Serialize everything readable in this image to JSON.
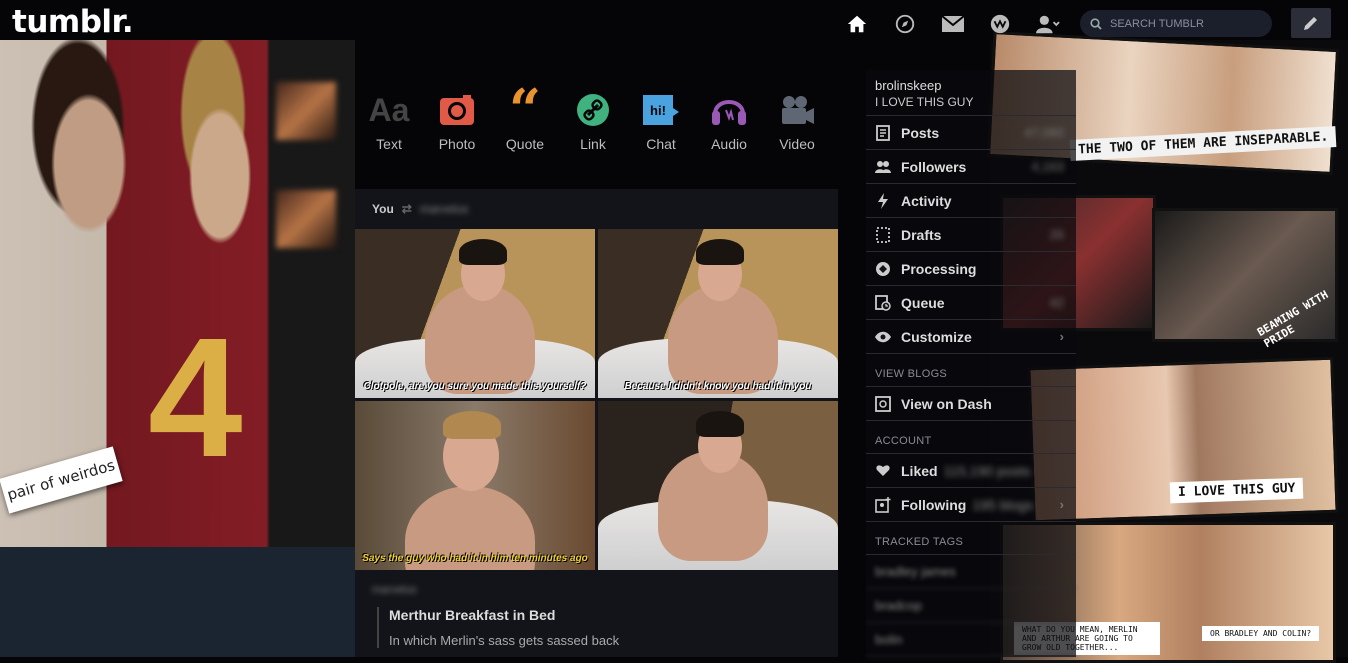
{
  "app": {
    "logo": "tumblr.",
    "search_placeholder": "Search Tumblr",
    "nav_icons": [
      "home-icon",
      "explore-icon",
      "inbox-icon",
      "activity-icon",
      "account-icon",
      "compose-icon"
    ]
  },
  "background": {
    "left_caption": "pair of weirdos",
    "right_captions": [
      "THE TWO OF THEM ARE INSEPARABLE.",
      "I LOVE THIS GUY",
      "BEAMING WITH PRIDE",
      "WHAT DO YOU MEAN, MERLIN AND ARTHUR ARE GOING TO GROW OLD TOGETHER...",
      "OR BRADLEY AND COLIN?"
    ]
  },
  "post_types": [
    {
      "label": "Text",
      "icon": "text-icon",
      "color": "#444444"
    },
    {
      "label": "Photo",
      "icon": "camera-icon",
      "color": "#e05a47"
    },
    {
      "label": "Quote",
      "icon": "quote-icon",
      "color": "#e8932d"
    },
    {
      "label": "Link",
      "icon": "link-icon",
      "color": "#3fb27f"
    },
    {
      "label": "Chat",
      "icon": "chat-icon",
      "color": "#4aa3df"
    },
    {
      "label": "Audio",
      "icon": "headphones-icon",
      "color": "#9b59b6"
    },
    {
      "label": "Video",
      "icon": "video-icon",
      "color": "#5f6775"
    }
  ],
  "post": {
    "author": "You",
    "reblogged_from": "marvelus",
    "subtitles": [
      "Clotpole, are you sure you made this yourself?",
      "Because I didn't know you had it in you",
      "Says the guy who had it in him ten minutes ago",
      ""
    ],
    "source_blog": "marvelus",
    "title": "Merthur Breakfast in Bed",
    "summary": "In which Merlin's sass gets sassed back"
  },
  "sidebar": {
    "blog_name": "brolinskeep",
    "blog_title": "I LOVE THIS GUY",
    "items": [
      {
        "label": "Posts",
        "icon": "posts-icon",
        "count": "47,080"
      },
      {
        "label": "Followers",
        "icon": "followers-icon",
        "count": "4,163"
      },
      {
        "label": "Activity",
        "icon": "activity-bolt-icon",
        "count": ""
      },
      {
        "label": "Drafts",
        "icon": "drafts-icon",
        "count": "26"
      },
      {
        "label": "Processing",
        "icon": "processing-icon",
        "count": ""
      },
      {
        "label": "Queue",
        "icon": "queue-icon",
        "count": "42"
      },
      {
        "label": "Customize",
        "icon": "customize-eye-icon",
        "count": ""
      }
    ],
    "view_blogs_header": "VIEW BLOGS",
    "view_on_dash": "View on Dash",
    "account_header": "ACCOUNT",
    "liked_label": "Liked",
    "liked_count": "115,190 posts",
    "following_label": "Following",
    "following_count": "195 blogs",
    "tracked_tags_header": "TRACKED TAGS",
    "tags": [
      "bradley james",
      "bradcop",
      "bolin"
    ]
  }
}
